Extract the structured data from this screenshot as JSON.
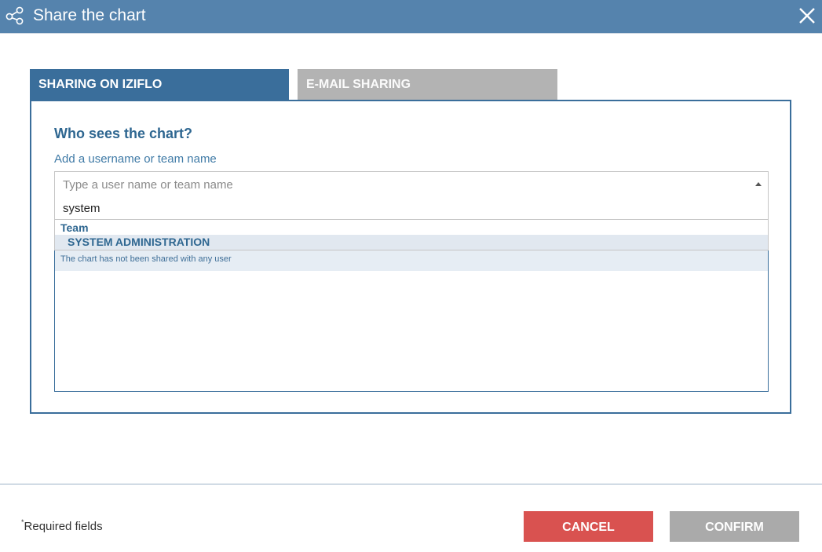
{
  "dialog": {
    "title": "Share the chart",
    "title_icon": "share-icon",
    "close_icon": "close-icon"
  },
  "tabs": [
    {
      "label": "SHARING ON IZIFLO",
      "active": true
    },
    {
      "label": "E-MAIL SHARING",
      "active": false
    }
  ],
  "panel": {
    "heading": "Who sees the chart?",
    "add_label": "Add a username or team name",
    "select": {
      "placeholder": "Type a user name or team name"
    },
    "dropdown": {
      "search_value": "system",
      "group_label": "Team",
      "options": [
        "SYSTEM ADMINISTRATION"
      ]
    },
    "info": "The chart has not been shared with any user"
  },
  "footer": {
    "required_marker": "*",
    "required_text": "Required fields",
    "cancel_label": "CANCEL",
    "confirm_label": "CONFIRM"
  },
  "colors": {
    "titlebar": "#5583ad",
    "accent": "#3a6e9b",
    "cancel": "#d95250",
    "confirm_disabled": "#aaaaaa"
  }
}
